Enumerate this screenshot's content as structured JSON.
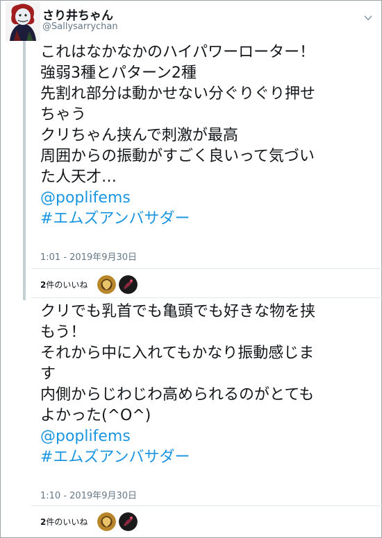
{
  "author": {
    "name": "さり井ちゃん",
    "handle": "@Sallysarrychan",
    "avatar_icon": "avatar-doll-icon"
  },
  "tweets": [
    {
      "lines": [
        "これはなかなかのハイパワーローター！",
        "強弱3種とパターン2種",
        "先割れ部分は動かせない分ぐりぐり押せ",
        "ちゃう",
        "クリちゃん挟んで刺激が最高",
        "周囲からの振動がすごく良いって気づい",
        "た人天才…"
      ],
      "mention": "@poplifems",
      "hashtag": "#エムズアンバサダー",
      "timestamp": "1:01 - 2019年9月30日",
      "likes_count": "2",
      "likes_label": "件のいいね"
    },
    {
      "lines": [
        "クリでも乳首でも亀頭でも好きな物を挟",
        "もう！",
        "それから中に入れてもかなり振動感じま",
        "す",
        "内側からじわじわ高められるのがとても",
        "よかった(^O^)"
      ],
      "mention": "@poplifems",
      "hashtag": "#エムズアンバサダー",
      "timestamp": "1:10 - 2019年9月30日",
      "likes_count": "2",
      "likes_label": "件のいいね"
    }
  ],
  "colors": {
    "link": "#1b95e0",
    "meta": "#657786",
    "thread_line": "#c4cfd6"
  },
  "icons": {
    "more": "chevron-down-icon",
    "liker_1": "liker-avatar-icon",
    "liker_2": "liker-avatar-icon"
  }
}
